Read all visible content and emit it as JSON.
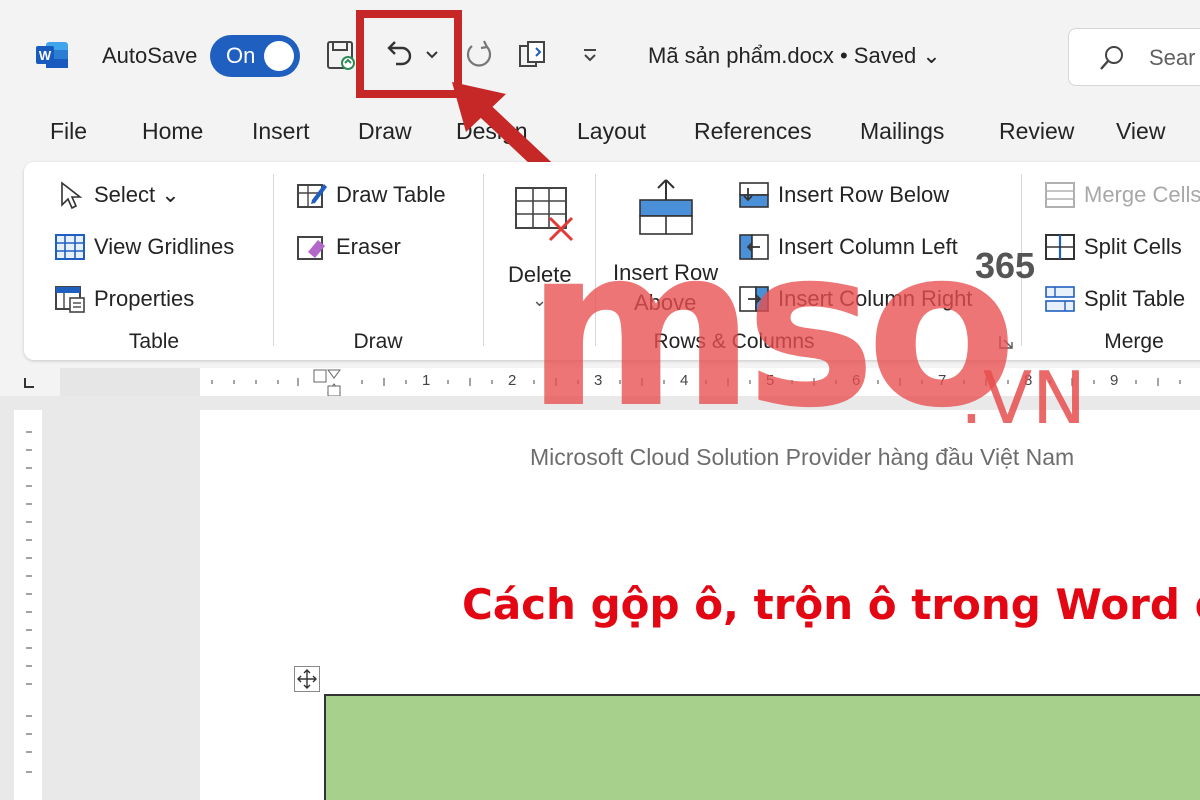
{
  "titlebar": {
    "autosave_label": "AutoSave",
    "toggle_label": "On",
    "document_title": "Mã sản phẩm.docx • Saved ⌄",
    "search_placeholder": "Sear"
  },
  "tabs": [
    "File",
    "Home",
    "Insert",
    "Draw",
    "Design",
    "Layout",
    "References",
    "Mailings",
    "Review",
    "View"
  ],
  "ribbon": {
    "table_group": {
      "label": "Table",
      "select": "Select ⌄",
      "view_gridlines": "View Gridlines",
      "properties": "Properties"
    },
    "draw_group": {
      "label": "Draw",
      "draw_table": "Draw Table",
      "eraser": "Eraser"
    },
    "delete": {
      "label": "Delete",
      "caret": "⌄"
    },
    "rows_columns_group": {
      "label": "Rows & Columns",
      "insert_row_above_1": "Insert Row",
      "insert_row_above_2": "Above",
      "insert_row_below": "Insert Row Below",
      "insert_column_left": "Insert Column Left",
      "insert_column_right": "Insert Column Right"
    },
    "merge_group": {
      "label": "Merge",
      "merge_cells": "Merge Cells",
      "split_cells": "Split Cells",
      "split_table": "Split Table"
    }
  },
  "ruler": {
    "numbers": [
      "1",
      "2",
      "3",
      "4",
      "5",
      "6",
      "7",
      "8",
      "9"
    ]
  },
  "document": {
    "heading": "Cách gộp ô, trộn ô trong Word để"
  },
  "watermark": {
    "letters": "mso",
    "domain": ".VN",
    "badge": "365",
    "tagline": "Microsoft Cloud Solution Provider hàng đầu Việt Nam"
  },
  "colors": {
    "accent": "#1f5fbf",
    "highlight": "#c62828",
    "heading": "#e30613",
    "table_fill": "#a8d08d"
  },
  "icons": [
    "word-logo-icon",
    "save-icon",
    "undo-icon",
    "undo-dropdown-icon",
    "redo-icon",
    "touch-mode-icon",
    "customize-toolbar-icon",
    "search-icon"
  ]
}
